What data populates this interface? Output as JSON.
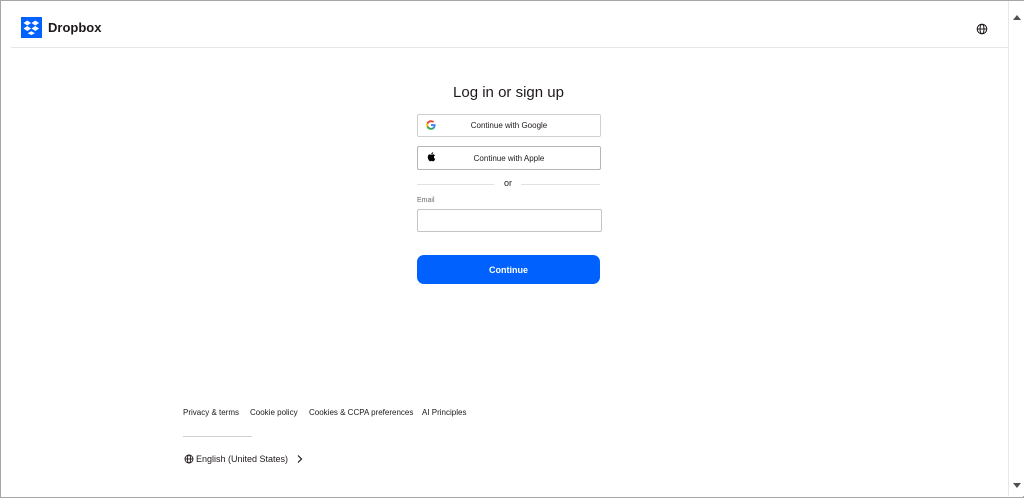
{
  "header": {
    "brand": "Dropbox",
    "brand_color": "#0061fe",
    "logo_icon": "dropbox-logo-icon",
    "language_icon": "globe-icon"
  },
  "login": {
    "title": "Log in or sign up",
    "google_label": "Continue with Google",
    "google_icon": "google-icon",
    "apple_label": "Continue with Apple",
    "apple_icon": "apple-icon",
    "or_text": "or",
    "email_label": "Email",
    "email_value": "",
    "continue_label": "Continue",
    "accent_color": "#0061fe"
  },
  "footer": {
    "links": [
      "Privacy & terms",
      "Cookie policy",
      "Cookies & CCPA preferences",
      "AI Principles"
    ],
    "language": "English (United States)",
    "language_icon": "globe-icon",
    "chevron_icon": "chevron-right-icon"
  }
}
